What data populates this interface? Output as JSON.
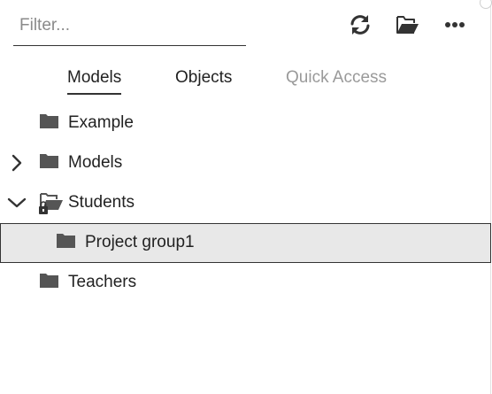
{
  "filter": {
    "placeholder": "Filter...",
    "value": ""
  },
  "toolbar": {
    "refresh_icon": "refresh-icon",
    "open_folder_icon": "folder-open-icon",
    "more_icon": "more-horizontal-icon"
  },
  "tabs": [
    {
      "label": "Models",
      "state": "active"
    },
    {
      "label": "Objects",
      "state": "normal"
    },
    {
      "label": "Quick Access",
      "state": "disabled"
    }
  ],
  "tree": [
    {
      "label": "Example",
      "level": 0,
      "expander": "none",
      "icon": "folder-icon"
    },
    {
      "label": "Models",
      "level": 0,
      "expander": "collapsed",
      "icon": "folder-icon"
    },
    {
      "label": "Students",
      "level": 0,
      "expander": "expanded",
      "icon": "folder-open-locked-icon"
    },
    {
      "label": "Project group1",
      "level": 1,
      "expander": "none",
      "icon": "folder-icon",
      "selected": true
    },
    {
      "label": "Teachers",
      "level": 0,
      "expander": "none",
      "icon": "folder-icon"
    }
  ],
  "colors": {
    "icon": "#555555",
    "selected_bg": "#e8e8e8",
    "disabled_text": "#9a9a9a"
  }
}
